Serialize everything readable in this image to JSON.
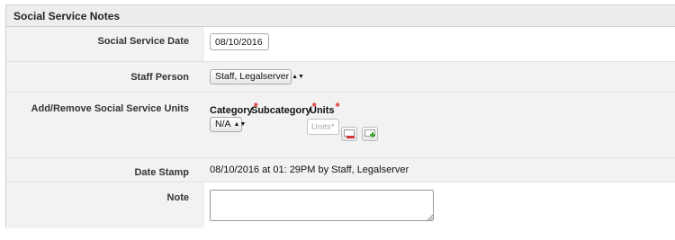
{
  "panel": {
    "title": "Social Service Notes"
  },
  "fields": {
    "date": {
      "label": "Social Service Date",
      "value": "08/10/2016"
    },
    "staff": {
      "label": "Staff Person",
      "selected": "Staff, Legalserver"
    },
    "units": {
      "label": "Add/Remove Social Service Units",
      "columns": {
        "category": "Category",
        "subcategory": "Subcategory",
        "units": "Units"
      },
      "required_marker": "*",
      "category_selected": "N/A",
      "units_placeholder": "Units*",
      "remove_icon": "remove-row-icon",
      "add_icon": "add-row-icon"
    },
    "stamp": {
      "label": "Date Stamp",
      "value": "08/10/2016 at 01: 29PM by Staff, Legalserver"
    },
    "note": {
      "label": "Note",
      "value": ""
    }
  },
  "colors": {
    "required": "#e03030",
    "add_icon": "#3aa635",
    "remove_icon": "#d13a3a"
  }
}
